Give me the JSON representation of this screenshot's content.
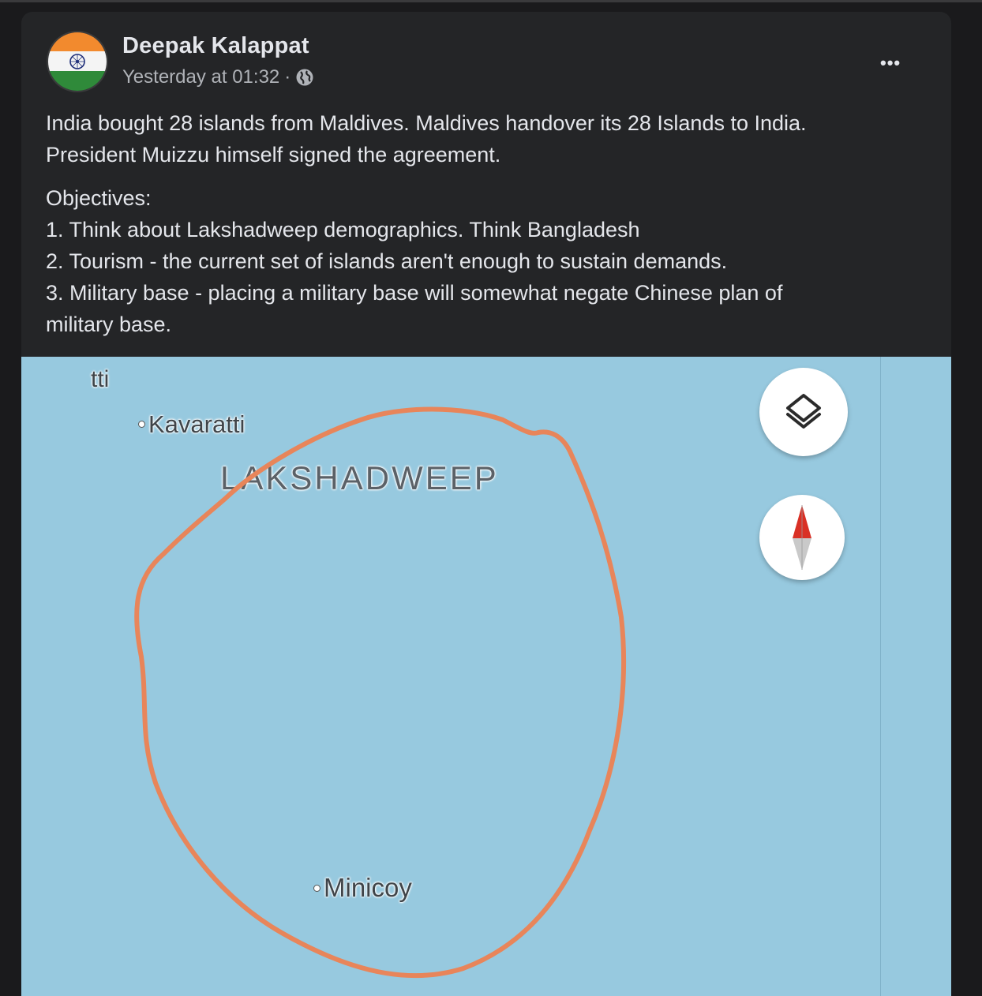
{
  "post": {
    "author": "Deepak Kalappat",
    "timestamp": "Yesterday at 01:32",
    "separator": "·",
    "privacy_icon": "globe-icon",
    "more_label": "•••",
    "body": {
      "paragraph1_line1": "India bought 28 islands from Maldives. Maldives handover its 28 Islands to India.",
      "paragraph1_line2": "President Muizzu himself signed the agreement.",
      "objectives_heading": "Objectives:",
      "objective1": "1. Think about Lakshadweep demographics. Think Bangladesh",
      "objective2": "2. Tourism - the current set of islands aren't enough to sustain demands.",
      "objective3_line1": "3. Military base - placing a military base will somewhat negate Chinese plan of",
      "objective3_line2": "military base."
    }
  },
  "map": {
    "partial_label": "tti",
    "place1": "Kavaratti",
    "region": "LAKSHADWEEP",
    "place2": "Minicoy",
    "layers_button_icon": "layers-icon",
    "compass_icon": "compass-icon",
    "colors": {
      "water": "#97c9df",
      "annotation": "#e8855a",
      "compass_north": "#d93025"
    }
  },
  "colors": {
    "background": "#1a1a1c",
    "card": "#242527",
    "text_primary": "#e4e6eb",
    "text_secondary": "#b0b3b8"
  }
}
